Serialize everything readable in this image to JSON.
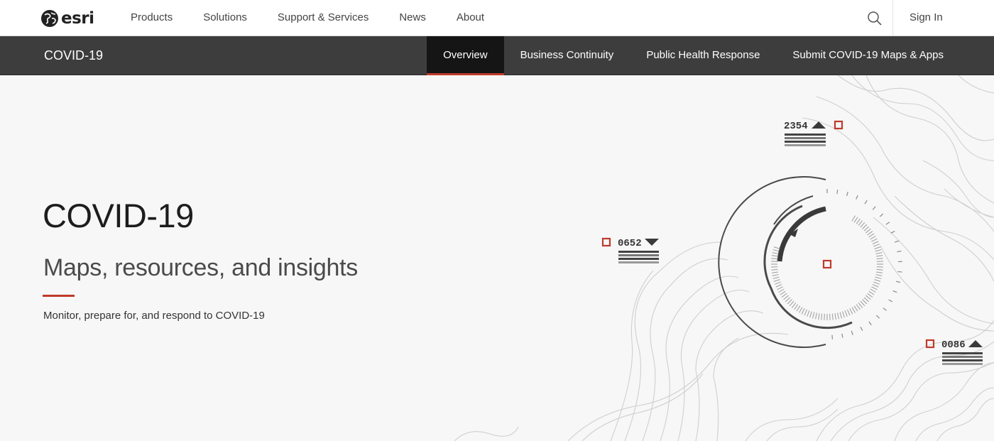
{
  "global_nav": {
    "logo_text": "esri",
    "menu": [
      "Products",
      "Solutions",
      "Support & Services",
      "News",
      "About"
    ],
    "search_icon": "search-icon",
    "signin_label": "Sign In"
  },
  "local_nav": {
    "title": "COVID-19",
    "tabs": [
      "Overview",
      "Business Continuity",
      "Public Health Response",
      "Submit COVID-19 Maps & Apps"
    ],
    "active_tab": "Overview"
  },
  "hero": {
    "title": "COVID-19",
    "subtitle": "Maps, resources, and insights",
    "description": "Monitor, prepare for, and respond to COVID-19"
  },
  "graphic": {
    "readouts": [
      {
        "value": "2354",
        "direction": "up"
      },
      {
        "value": "0652",
        "direction": "down"
      },
      {
        "value": "0086",
        "direction": "up"
      }
    ]
  },
  "colors": {
    "accent": "#c0392b",
    "local_nav_bg": "#3d3d3d",
    "active_tab_bg": "#151515",
    "hero_bg": "#f7f7f7"
  }
}
